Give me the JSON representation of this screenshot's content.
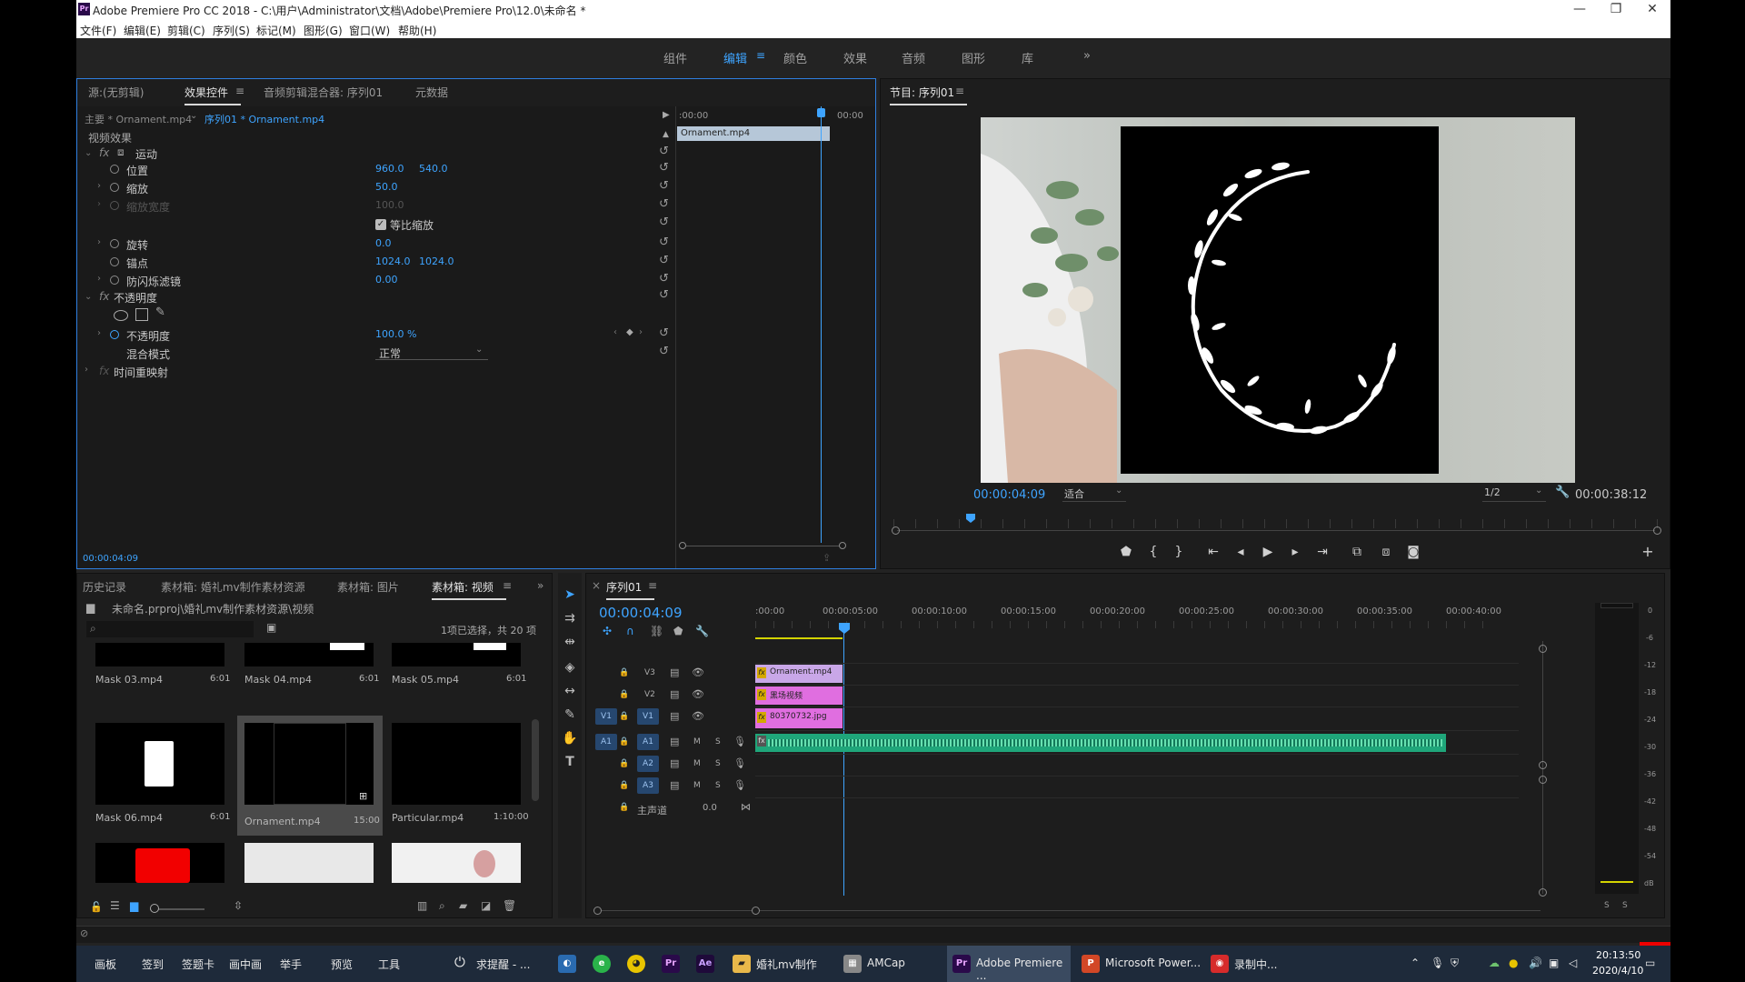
{
  "window": {
    "title": "Adobe Premiere Pro CC 2018 - C:\\用户\\Administrator\\文档\\Adobe\\Premiere Pro\\12.0\\未命名 *",
    "logo": "Pr"
  },
  "menu": [
    "文件(F)",
    "编辑(E)",
    "剪辑(C)",
    "序列(S)",
    "标记(M)",
    "图形(G)",
    "窗口(W)",
    "帮助(H)"
  ],
  "workspaces": {
    "items": [
      "组件",
      "编辑",
      "颜色",
      "效果",
      "音频",
      "图形",
      "库"
    ],
    "active": "编辑",
    "more": "»"
  },
  "effect_controls": {
    "tabs": [
      "源:(无剪辑)",
      "效果控件",
      "音频剪辑混合器: 序列01",
      "元数据"
    ],
    "active_tab": "效果控件",
    "master": "主要 * Ornament.mp4",
    "sequence_clip": "序列01 * Ornament.mp4",
    "section": "视频效果",
    "motion": "运动",
    "position": {
      "label": "位置",
      "x": "960.0",
      "y": "540.0"
    },
    "scale": {
      "label": "缩放",
      "value": "50.0"
    },
    "scale_width": {
      "label": "缩放宽度",
      "value": "100.0"
    },
    "uniform_scale": "等比缩放",
    "rotation": {
      "label": "旋转",
      "value": "0.0"
    },
    "anchor": {
      "label": "锚点",
      "x": "1024.0",
      "y": "1024.0"
    },
    "anti_flicker": {
      "label": "防闪烁滤镜",
      "value": "0.00"
    },
    "opacity_group": "不透明度",
    "opacity": {
      "label": "不透明度",
      "value": "100.0 %"
    },
    "blend": {
      "label": "混合模式",
      "value": "正常"
    },
    "time_remap": "时间重映射",
    "timecode": "00:00:04:09",
    "mini_ruler": {
      "start": ":00:00",
      "end": "00:00"
    },
    "mini_clip": "Ornament.mp4"
  },
  "program": {
    "title": "节目: 序列01",
    "timecode": "00:00:04:09",
    "fit": "适合",
    "resolution": "1/2",
    "duration": "00:00:38:12"
  },
  "project": {
    "tabs": [
      "历史记录",
      "素材箱: 婚礼mv制作素材资源",
      "素材箱: 图片",
      "素材箱: 视频"
    ],
    "active_tab": "素材箱: 视频",
    "path": "未命名.prproj\\婚礼mv制作素材资源\\视频",
    "selection": "1项已选择，共 20 项",
    "items": [
      {
        "name": "Mask 03.mp4",
        "dur": "6:01"
      },
      {
        "name": "Mask 04.mp4",
        "dur": "6:01"
      },
      {
        "name": "Mask 05.mp4",
        "dur": "6:01"
      },
      {
        "name": "Mask 06.mp4",
        "dur": "6:01"
      },
      {
        "name": "Ornament.mp4",
        "dur": "15:00"
      },
      {
        "name": "Particular.mp4",
        "dur": "1:10:00"
      }
    ]
  },
  "timeline": {
    "title": "序列01",
    "timecode": "00:00:04:09",
    "ruler": [
      ":00:00",
      "00:00:05:00",
      "00:00:10:00",
      "00:00:15:00",
      "00:00:20:00",
      "00:00:25:00",
      "00:00:30:00",
      "00:00:35:00",
      "00:00:40:00"
    ],
    "tracks": [
      {
        "id": "V3",
        "clip": "Ornament.mp4"
      },
      {
        "id": "V2",
        "clip": "黑场视频"
      },
      {
        "id": "V1",
        "clip": "80370732.jpg"
      },
      {
        "id": "A1"
      },
      {
        "id": "A2"
      },
      {
        "id": "A3"
      }
    ],
    "master": {
      "label": "主声道",
      "value": "0.0"
    },
    "meter_scale": [
      "0",
      "-6",
      "-12",
      "-18",
      "-24",
      "-30",
      "-36",
      "-42",
      "-48",
      "-54",
      "dB"
    ],
    "meter_solo": [
      "S",
      "S"
    ]
  },
  "taskbar": {
    "left": [
      "画板",
      "签到",
      "签题卡",
      "画中画",
      "举手",
      "预览",
      "工具"
    ],
    "wake": "求提醒 - ...",
    "apps": [
      {
        "label": "婚礼mv制作"
      },
      {
        "label": "AMCap"
      },
      {
        "label": "Adobe Premiere ..."
      },
      {
        "label": "Microsoft Power..."
      },
      {
        "label": "录制中..."
      }
    ],
    "time": "20:13:50",
    "date": "2020/4/10"
  },
  "colors": {
    "accent": "#3ea4ff",
    "clip_pink": "#e06ee0",
    "clip_violet": "#c9a7e8",
    "audio": "#1fa67a"
  }
}
